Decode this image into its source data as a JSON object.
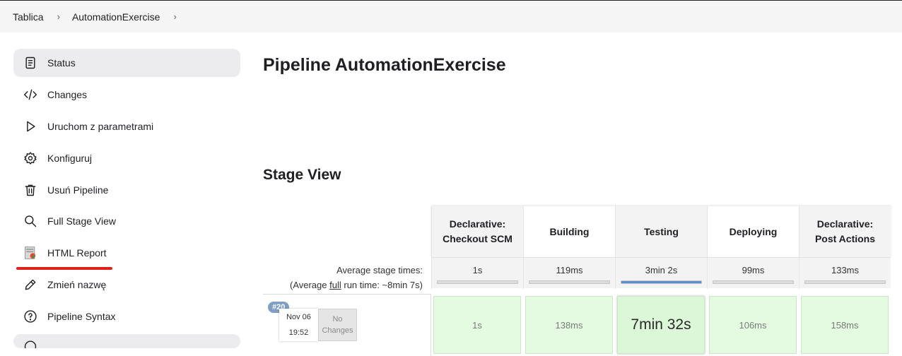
{
  "breadcrumb": {
    "items": [
      "Tablica",
      "AutomationExercise"
    ]
  },
  "sidebar": {
    "items": [
      {
        "label": "Status",
        "icon": "document-icon"
      },
      {
        "label": "Changes",
        "icon": "code-icon"
      },
      {
        "label": "Uruchom z parametrami",
        "icon": "play-icon"
      },
      {
        "label": "Konfiguruj",
        "icon": "gear-icon"
      },
      {
        "label": "Usuń Pipeline",
        "icon": "trash-icon"
      },
      {
        "label": "Full Stage View",
        "icon": "search-icon"
      },
      {
        "label": "HTML Report",
        "icon": "report-icon"
      },
      {
        "label": "Zmień nazwę",
        "icon": "pencil-icon"
      },
      {
        "label": "Pipeline Syntax",
        "icon": "help-icon"
      }
    ]
  },
  "main": {
    "title": "Pipeline AutomationExercise",
    "stage_view_title": "Stage View"
  },
  "stage_view": {
    "stages": [
      {
        "line1": "Declarative:",
        "line2": "Checkout SCM"
      },
      {
        "line1": "Building",
        "line2": ""
      },
      {
        "line1": "Testing",
        "line2": ""
      },
      {
        "line1": "Deploying",
        "line2": ""
      },
      {
        "line1": "Declarative:",
        "line2": "Post Actions"
      }
    ],
    "avg_label_line1": "Average stage times:",
    "avg_label_pre": "(Average ",
    "avg_label_full": "full",
    "avg_label_post": " run time: ~8min 7s)",
    "avg_times": [
      "1s",
      "119ms",
      "3min 2s",
      "99ms",
      "133ms"
    ],
    "avg_progress": [
      0,
      0,
      1,
      0,
      0
    ],
    "build": {
      "badge": "#20",
      "date": "Nov 06",
      "time": "19:52",
      "changes_line1": "No",
      "changes_line2": "Changes",
      "times": [
        "1s",
        "138ms",
        "7min 32s",
        "106ms",
        "158ms"
      ]
    }
  },
  "colors": {
    "accent_underline": "#e0201b",
    "success_cell": "#e4fbe1",
    "progress": "#5b8fd6",
    "badge": "#7f9ec6"
  }
}
